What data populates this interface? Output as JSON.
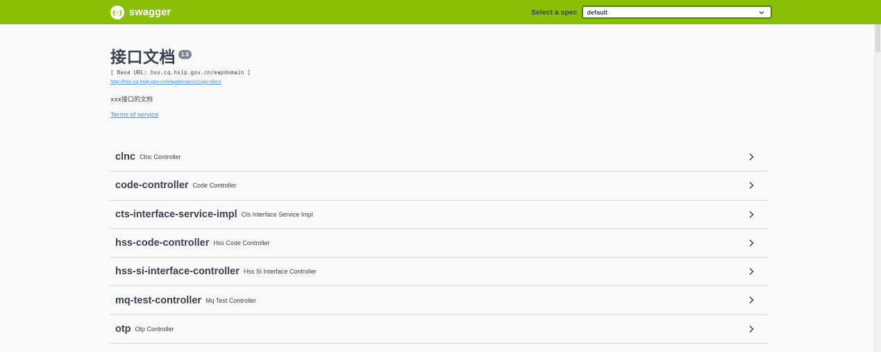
{
  "header": {
    "brand": "swagger",
    "spec_label": "Select a spec",
    "spec_value": "default"
  },
  "info": {
    "title": "接口文档",
    "version": "1.0",
    "base_url": "[ Base URL: hss.cq.hsip.gov.cn/eapdomain ]",
    "api_docs_link": "http://hss.cq.hsip.gov.cn/eapdomain/v2/api-docs",
    "description": "xxx接口的文档",
    "terms": "Terms of service"
  },
  "tags": [
    {
      "name": "clnc",
      "description": "Clnc Controller"
    },
    {
      "name": "code-controller",
      "description": "Code Controller"
    },
    {
      "name": "cts-interface-service-impl",
      "description": "Cts Interface Service Impl"
    },
    {
      "name": "hss-code-controller",
      "description": "Hss Code Controller"
    },
    {
      "name": "hss-si-interface-controller",
      "description": "Hss Si Interface Controller"
    },
    {
      "name": "mq-test-controller",
      "description": "Mq Test Controller"
    },
    {
      "name": "otp",
      "description": "Otp Controller"
    }
  ],
  "colors": {
    "topbar": "#89bf04",
    "link": "#4990e2",
    "text": "#3b4151"
  },
  "icons": {
    "brand": "swagger-logo-icon",
    "select": "chevron-down-icon",
    "tag": "chevron-right-icon"
  }
}
